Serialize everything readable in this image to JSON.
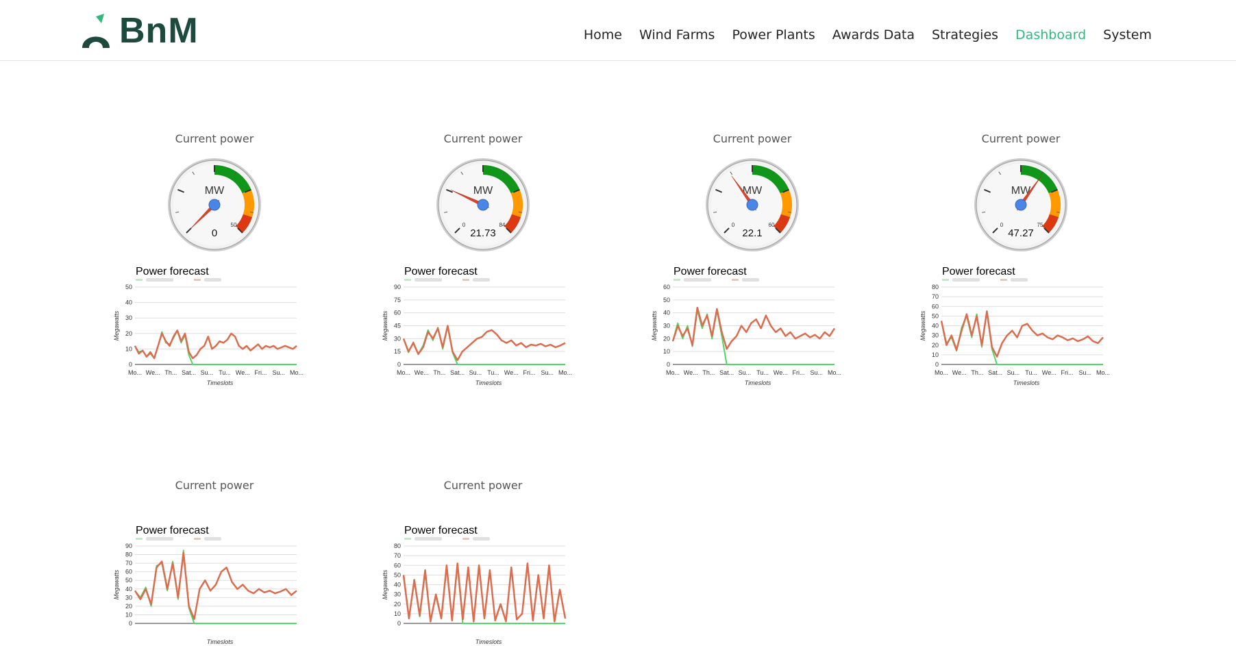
{
  "logo": {
    "text": "BnM"
  },
  "nav": [
    {
      "label": "Home",
      "active": false
    },
    {
      "label": "Wind Farms",
      "active": false
    },
    {
      "label": "Power Plants",
      "active": false
    },
    {
      "label": "Awards Data",
      "active": false
    },
    {
      "label": "Strategies",
      "active": false
    },
    {
      "label": "Dashboard",
      "active": true
    },
    {
      "label": "System",
      "active": false
    }
  ],
  "colors": {
    "accent": "#2fb97f",
    "forecast_actual": "#dd6b4d",
    "forecast_green": "#4cd964",
    "needle": "#d9452b",
    "hub": "#4a86e8"
  },
  "panels": [
    {
      "name": "",
      "current_power_label": "Current power",
      "gauge": {
        "unit": "MW",
        "value": 0,
        "value_label": "0",
        "min_label": "",
        "max": 50,
        "max_label": "50"
      },
      "caption_line1": "",
      "caption_line2": ""
    },
    {
      "name": "",
      "current_power_label": "Current power",
      "gauge": {
        "unit": "MW",
        "value": 21.73,
        "value_label": "21.73",
        "min_label": "0",
        "max": 84,
        "max_label": "84"
      },
      "caption_line1": "",
      "caption_line2": ""
    },
    {
      "name": "",
      "current_power_label": "Current power",
      "gauge": {
        "unit": "MW",
        "value": 22.1,
        "value_label": "22.1",
        "min_label": "0",
        "max": 60,
        "max_label": "60"
      },
      "caption_line1": "",
      "caption_line2": ""
    },
    {
      "name": "",
      "current_power_label": "Current power",
      "gauge": {
        "unit": "MW",
        "value": 47.27,
        "value_label": "47.27",
        "min_label": "0",
        "max": 75,
        "max_label": "75"
      },
      "caption_line1": "",
      "caption_line2": ""
    },
    {
      "name": "",
      "current_power_label": "Current power",
      "caption_line1": "",
      "caption_line2": ""
    },
    {
      "name": "",
      "current_power_label": "Current power",
      "caption_line1": "",
      "caption_line2": ""
    }
  ],
  "chart_data": [
    {
      "type": "line",
      "title": "Power forecast",
      "xlabel": "Timeslots",
      "ylabel": "Megawatts",
      "x_ticks": [
        "Mo...",
        "We...",
        "Th...",
        "Sat...",
        "Su...",
        "Tu...",
        "We...",
        "Fri...",
        "Su...",
        "Mo..."
      ],
      "y_ticks": [
        0,
        10,
        20,
        30,
        40,
        50
      ],
      "ylim": [
        0,
        50
      ],
      "series": [
        {
          "values": [
            12,
            7,
            9,
            5,
            8,
            4,
            12,
            20,
            15,
            12,
            18,
            22,
            15,
            20,
            8,
            4,
            6,
            10,
            12,
            18,
            10,
            12,
            15,
            14,
            16,
            20,
            18,
            12,
            10,
            12,
            9,
            11,
            13,
            10,
            12,
            11,
            12,
            10,
            11,
            12,
            11,
            10,
            12
          ]
        },
        {
          "values": [
            12,
            8,
            9,
            5,
            7,
            4,
            12,
            21,
            14,
            13,
            17,
            22,
            14,
            19,
            6,
            0,
            0,
            0,
            0,
            0,
            0,
            0,
            0,
            0,
            0,
            0,
            0,
            0,
            0,
            0,
            0,
            0,
            0,
            0,
            0,
            0,
            0,
            0,
            0,
            0,
            0,
            0,
            0
          ]
        }
      ]
    },
    {
      "type": "line",
      "title": "Power forecast",
      "xlabel": "Timeslots",
      "ylabel": "Megawatts",
      "x_ticks": [
        "Mo...",
        "We...",
        "Th...",
        "Sat...",
        "Su...",
        "Tu...",
        "We...",
        "Fri...",
        "Su...",
        "Mo..."
      ],
      "y_ticks": [
        0,
        15,
        30,
        45,
        60,
        75,
        90
      ],
      "ylim": [
        0,
        90
      ],
      "series": [
        {
          "values": [
            30,
            15,
            25,
            12,
            20,
            38,
            30,
            42,
            20,
            45,
            15,
            5,
            15,
            20,
            25,
            30,
            32,
            38,
            40,
            35,
            28,
            25,
            28,
            22,
            25,
            20,
            23,
            22,
            24,
            21,
            23,
            20,
            22,
            25
          ]
        },
        {
          "values": [
            30,
            14,
            26,
            12,
            22,
            40,
            28,
            43,
            18,
            44,
            14,
            0,
            0,
            0,
            0,
            0,
            0,
            0,
            0,
            0,
            0,
            0,
            0,
            0,
            0,
            0,
            0,
            0,
            0,
            0,
            0,
            0,
            0,
            0
          ]
        }
      ]
    },
    {
      "type": "line",
      "title": "Power forecast",
      "xlabel": "Timeslots",
      "ylabel": "Megawatts",
      "x_ticks": [
        "Mo...",
        "We...",
        "Th...",
        "Sat...",
        "Su...",
        "Tu...",
        "We...",
        "Fri...",
        "Su...",
        "Mo..."
      ],
      "y_ticks": [
        0,
        10,
        20,
        30,
        40,
        50,
        60
      ],
      "ylim": [
        0,
        60
      ],
      "series": [
        {
          "values": [
            18,
            30,
            22,
            28,
            15,
            44,
            30,
            38,
            22,
            43,
            25,
            12,
            18,
            22,
            30,
            25,
            32,
            35,
            28,
            38,
            30,
            25,
            28,
            22,
            25,
            20,
            22,
            24,
            21,
            23,
            20,
            25,
            22,
            28
          ]
        },
        {
          "values": [
            18,
            32,
            20,
            30,
            14,
            42,
            28,
            39,
            20,
            42,
            22,
            0,
            0,
            0,
            0,
            0,
            0,
            0,
            0,
            0,
            0,
            0,
            0,
            0,
            0,
            0,
            0,
            0,
            0,
            0,
            0,
            0,
            0,
            0
          ]
        }
      ]
    },
    {
      "type": "line",
      "title": "Power forecast",
      "xlabel": "Timeslots",
      "ylabel": "Megawatts",
      "x_ticks": [
        "Mo...",
        "We...",
        "Th...",
        "Sat...",
        "Su...",
        "Tu...",
        "We...",
        "Fri...",
        "Su...",
        "Mo..."
      ],
      "y_ticks": [
        0,
        10,
        20,
        30,
        40,
        50,
        60,
        70,
        80
      ],
      "ylim": [
        0,
        80
      ],
      "series": [
        {
          "values": [
            45,
            20,
            30,
            15,
            35,
            52,
            30,
            50,
            20,
            55,
            18,
            8,
            22,
            30,
            35,
            28,
            40,
            42,
            35,
            30,
            32,
            28,
            26,
            30,
            28,
            25,
            27,
            24,
            26,
            29,
            24,
            22,
            28
          ]
        },
        {
          "values": [
            45,
            22,
            28,
            14,
            38,
            50,
            28,
            52,
            18,
            54,
            16,
            0,
            0,
            0,
            0,
            0,
            0,
            0,
            0,
            0,
            0,
            0,
            0,
            0,
            0,
            0,
            0,
            0,
            0,
            0,
            0,
            0,
            0
          ]
        }
      ]
    },
    {
      "type": "line",
      "title": "Power forecast",
      "xlabel": "Timeslots",
      "ylabel": "Megawatts",
      "y_ticks": [
        0,
        10,
        20,
        30,
        40,
        50,
        60,
        70,
        80,
        90
      ],
      "ylim": [
        0,
        90
      ],
      "series": [
        {
          "values": [
            38,
            28,
            40,
            22,
            65,
            72,
            40,
            70,
            30,
            82,
            20,
            5,
            40,
            50,
            38,
            45,
            60,
            65,
            48,
            40,
            45,
            38,
            35,
            40,
            36,
            38,
            35,
            37,
            40,
            33,
            38
          ]
        },
        {
          "values": [
            38,
            30,
            42,
            20,
            67,
            70,
            38,
            72,
            28,
            85,
            18,
            0,
            0,
            0,
            0,
            0,
            0,
            0,
            0,
            0,
            0,
            0,
            0,
            0,
            0,
            0,
            0,
            0,
            0,
            0,
            0
          ]
        }
      ]
    },
    {
      "type": "line",
      "title": "Power forecast",
      "xlabel": "Timeslots",
      "ylabel": "Megawatts",
      "y_ticks": [
        0,
        10,
        20,
        30,
        40,
        50,
        60,
        70,
        80
      ],
      "ylim": [
        0,
        80
      ],
      "series": [
        {
          "values": [
            50,
            5,
            45,
            8,
            55,
            2,
            30,
            5,
            60,
            3,
            62,
            4,
            58,
            2,
            60,
            5,
            55,
            3,
            20,
            2,
            58,
            4,
            10,
            62,
            3,
            50,
            5,
            60,
            2,
            35,
            5
          ]
        },
        {
          "values": [
            48,
            6,
            43,
            7,
            52,
            3,
            28,
            5,
            58,
            4,
            60,
            0,
            0,
            0,
            0,
            0,
            0,
            0,
            0,
            0,
            0,
            0,
            0,
            0,
            0,
            0,
            0,
            0,
            0,
            0,
            0
          ]
        }
      ]
    }
  ]
}
